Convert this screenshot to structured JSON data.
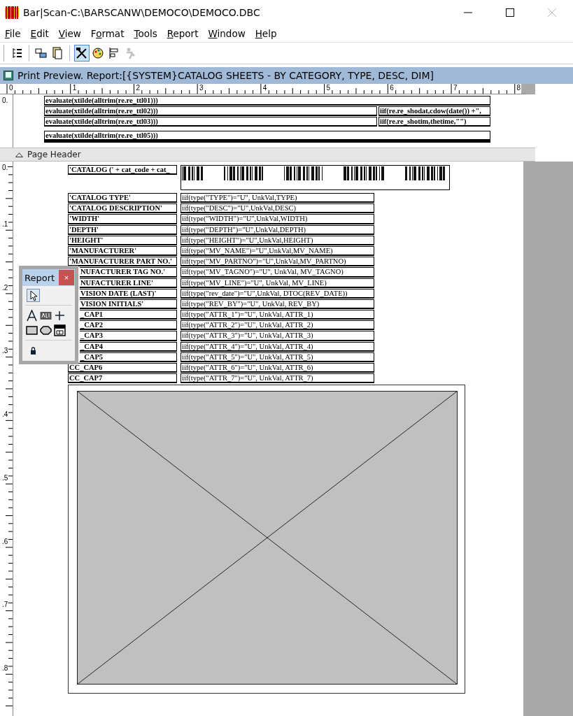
{
  "window": {
    "title": "Bar|Scan-C:\\BARSCANW\\DEMOCO\\DEMOCO.DBC"
  },
  "menu": [
    {
      "key": "F",
      "post": "ile"
    },
    {
      "key": "E",
      "post": "dit"
    },
    {
      "key": "V",
      "post": "iew"
    },
    {
      "pre": "F",
      "key": "o",
      "post": "rmat"
    },
    {
      "key": "T",
      "post": "ools"
    },
    {
      "key": "R",
      "post": "eport"
    },
    {
      "key": "W",
      "post": "indow"
    },
    {
      "key": "H",
      "post": "elp"
    }
  ],
  "toolbar": [
    {
      "kind": "tree",
      "pressed": false,
      "disabled": false
    },
    {
      "kind": "separator"
    },
    {
      "kind": "network",
      "pressed": false,
      "disabled": false
    },
    {
      "kind": "pages",
      "pressed": false,
      "disabled": false
    },
    {
      "kind": "separator"
    },
    {
      "kind": "tools",
      "pressed": true,
      "disabled": false
    },
    {
      "kind": "palette",
      "pressed": false,
      "disabled": false
    },
    {
      "kind": "align",
      "pressed": false,
      "disabled": false
    },
    {
      "kind": "figure",
      "pressed": false,
      "disabled": true
    }
  ],
  "document": {
    "title": "Print Preview. Report:[{SYSTEM}CATALOG SHEETS - BY CATEGORY, TYPE, DESC, DIM]"
  },
  "ruler": {
    "numbers": [
      "0",
      "1",
      "2",
      "3",
      "4",
      "5",
      "6",
      "7",
      "8"
    ]
  },
  "title_band": {
    "ruler_numbers": [
      "0."
    ],
    "rows": [
      {
        "kind": "plain",
        "cells": [
          "evaluate(xtilde(alltrim(re.re_ttl01)))"
        ]
      },
      {
        "kind": "plain",
        "cells": [
          "evaluate(xtilde(alltrim(re.re_ttl02)))",
          "iif(re.re_shodat,cdow(date()) +\","
        ]
      },
      {
        "kind": "plain",
        "cells": [
          "evaluate(xtilde(alltrim(re.re_ttl03)))",
          "iif(re.re_shotim,thetime,\"\")"
        ]
      },
      {
        "kind": "heavy",
        "cells": [
          "evaluate(xtilde(alltrim(re.re_ttl05)))"
        ]
      }
    ]
  },
  "band_bar": {
    "label": "Page Header"
  },
  "page_header": {
    "ruler_numbers": [
      "0.",
      ".1",
      ".2",
      ".3",
      ".4",
      ".5",
      ".6",
      ".7",
      ".8"
    ],
    "catalog_label": "'CATALOG (' + cat_code + cat_",
    "rows": [
      {
        "label": "'CATALOG TYPE'",
        "expression": "iif(type(\"TYPE\")=\"U\", UnkVal,TYPE)",
        "covered": false
      },
      {
        "label": "'CATALOG DESCRIPTION'",
        "expression": "iif(type(\"DESC\")=\"U\",UnkVal,DESC)",
        "covered": false
      },
      {
        "label": "'WIDTH'",
        "expression": "iif(type(\"WIDTH\")=\"U\",UnkVal,WIDTH)",
        "covered": false
      },
      {
        "label": "'DEPTH'",
        "expression": "iif(type(\"DEPTH\")=\"U\",UnkVal,DEPTH)",
        "covered": false
      },
      {
        "label": "'HEIGHT'",
        "expression": "iif(type(\"HEIGHT\")=\"U\",UnkVal,HEIGHT)",
        "covered": false
      },
      {
        "label": "'MANUFACTURER'",
        "expression": "iif(type(\"MV_NAME\")=\"U\",UnkVal,MV_NAME)",
        "covered": false
      },
      {
        "label": "'MANUFACTURER PART NO.'",
        "expression": "iif(type(\"MV_PARTNO\")=\"U\",UnkVal,MV_PARTNO)",
        "covered": false
      },
      {
        "label": "NUFACTURER TAG NO.'",
        "expression": "iif(type(\"MV_TAGNO\")=\"U\", UnkVal, MV_TAGNO)",
        "covered": true
      },
      {
        "label": "NUFACTURER LINE'",
        "expression": "iif(type(\"MV_LINE\")=\"U\", UnkVal, MV_LINE)",
        "covered": true
      },
      {
        "label": "VISION DATE (LAST)'",
        "expression": "iif(type(\"rev_date\")=\"U\",UnkVal, DTOC(REV_DATE))",
        "covered": true
      },
      {
        "label": "VISION INITIALS'",
        "expression": "iif(type(\"REV_BY\")=\"U\", UnkVal, REV_BY)",
        "covered": true
      },
      {
        "label": "_CAP1",
        "expression": "iif(type(\"ATTR_1\")=\"U\", UnkVal, ATTR_1)",
        "covered": true
      },
      {
        "label": "_CAP2",
        "expression": "iif(type(\"ATTR_2\")=\"U\", UnkVal, ATTR_2)",
        "covered": true
      },
      {
        "label": "_CAP3",
        "expression": "iif(type(\"ATTR_3\")=\"U\", UnkVal, ATTR_3)",
        "covered": true
      },
      {
        "label": "_CAP4",
        "expression": "iif(type(\"ATTR_4\")=\"U\", UnkVal, ATTR_4)",
        "covered": true
      },
      {
        "label": "_CAP5",
        "expression": "iif(type(\"ATTR_5\")=\"U\", UnkVal, ATTR_5)",
        "covered": true
      },
      {
        "label": "CC_CAP6",
        "expression": "iif(type(\"ATTR_6\")=\"U\", UnkVal, ATTR_6)",
        "covered": false
      },
      {
        "label": "CC_CAP7",
        "expression": "iif(type(\"ATTR_7\")=\"U\", UnkVal, ATTR_7)",
        "covered": false
      }
    ]
  },
  "toolbox": {
    "title": "Report",
    "close": "×",
    "tools": [
      {
        "kind": "pointer",
        "selected": true
      },
      {
        "kind": "separator"
      },
      {
        "kind": "text",
        "selected": false
      },
      {
        "kind": "field",
        "selected": false
      },
      {
        "kind": "line",
        "selected": false
      },
      {
        "kind": "rect",
        "selected": false
      },
      {
        "kind": "rounded",
        "selected": false
      },
      {
        "kind": "ole",
        "selected": false
      },
      {
        "kind": "separator"
      },
      {
        "kind": "lock",
        "selected": false
      }
    ]
  }
}
